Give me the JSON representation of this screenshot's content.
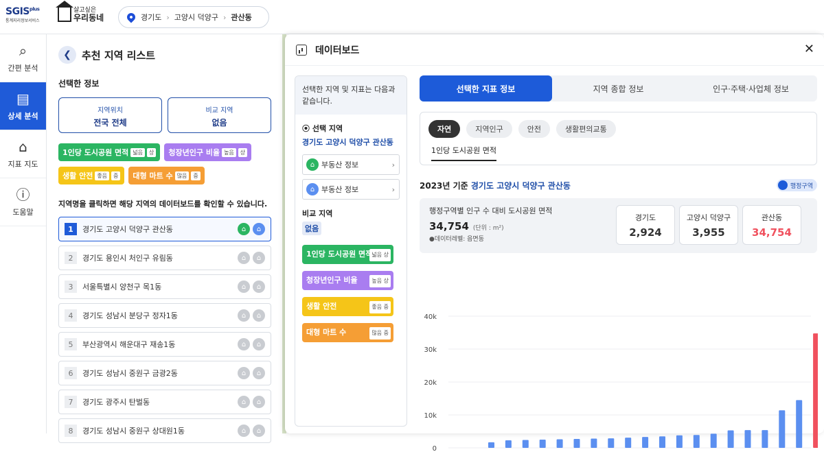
{
  "logo": {
    "main": "SGIS",
    "sup": "plus",
    "sub": "통계지리정보서비스"
  },
  "brand": {
    "line1": "살고싶은",
    "line2": "우리동네"
  },
  "breadcrumb": [
    "경기도",
    "고양시 덕양구",
    "관산동"
  ],
  "nav": [
    {
      "label": "간편 분석",
      "icon": "search-chart-icon"
    },
    {
      "label": "상세 분석",
      "icon": "document-search-icon"
    },
    {
      "label": "지표 지도",
      "icon": "house-map-icon"
    },
    {
      "label": "도움말",
      "icon": "info-icon"
    }
  ],
  "left": {
    "title": "추천 지역 리스트",
    "selected_label": "선택한 정보",
    "loc_title": "지역위치",
    "loc_value": "전국 전체",
    "cmp_title": "비교 지역",
    "cmp_value": "없음",
    "tags": [
      {
        "name": "1인당 도시공원 면적",
        "p1": "넓음",
        "p2": "상",
        "color": "#2bb562"
      },
      {
        "name": "청장년인구 비율",
        "p1": "높음",
        "p2": "상",
        "color": "#a97df0"
      },
      {
        "name": "생활 안전",
        "p1": "좋음",
        "p2": "중",
        "color": "#f5c518"
      },
      {
        "name": "대형 마트 수",
        "p1": "많음",
        "p2": "중",
        "color": "#f59e35"
      }
    ],
    "hint": "지역명을 클릭하면 해당 지역의 데이터보드를 확인할 수 있습니다.",
    "list": [
      {
        "rank": "1",
        "name": "경기도 고양시 덕양구 관산동"
      },
      {
        "rank": "2",
        "name": "경기도 용인시 처인구 유림동"
      },
      {
        "rank": "3",
        "name": "서울특별시 양천구 목1동"
      },
      {
        "rank": "4",
        "name": "경기도 성남시 분당구 정자1동"
      },
      {
        "rank": "5",
        "name": "부산광역시 해운대구 재송1동"
      },
      {
        "rank": "6",
        "name": "경기도 성남시 중원구 금광2동"
      },
      {
        "rank": "7",
        "name": "경기도 광주시 탄벌동"
      },
      {
        "rank": "8",
        "name": "경기도 성남시 중원구 상대원1동"
      }
    ]
  },
  "dashboard": {
    "title": "데이터보드",
    "intro": "선택한 지역 및 지표는 다음과 같습니다.",
    "sel_region_label": "선택 지역",
    "sel_region": "경기도 고양시 덕양구 관산동",
    "realestate1": "부동산 정보",
    "realestate2": "부동산 정보",
    "cmp_label": "비교 지역",
    "cmp_value": "없음",
    "tabs": [
      "선택한 지표 정보",
      "지역 종합 정보",
      "인구·주택·사업체 정보"
    ],
    "pills": [
      "자연",
      "지역인구",
      "안전",
      "생활편의교통"
    ],
    "subtab": "1인당 도시공원 면적",
    "year_prefix": "2023년 기준",
    "year_region": "경기도 고양시 덕양구 관산동",
    "toggle": "행정구역",
    "stat_desc": "행정구역별 인구 수 대비 도시공원 면적",
    "stat_value": "34,754",
    "stat_unit": "(단위 : m²)",
    "stat_level": "●데이터레벨: 읍면동",
    "cards": [
      {
        "name": "경기도",
        "value": "2,924"
      },
      {
        "name": "고양시 덕양구",
        "value": "3,955"
      },
      {
        "name": "관산동",
        "value": "34,754"
      }
    ]
  },
  "chart_data": {
    "type": "bar",
    "yticks": [
      "40k",
      "30k",
      "20k",
      "10k",
      "0"
    ],
    "ylim": [
      0,
      40000
    ],
    "values": [
      1700,
      2300,
      2400,
      2500,
      2600,
      2700,
      2800,
      2900,
      3100,
      3300,
      3500,
      3800,
      3900,
      4300,
      5300,
      5400,
      5400,
      11400,
      14500,
      34754
    ],
    "colors": {
      "default": "#5b8ff0",
      "highlight": "#f0515e"
    },
    "highlight_index": 19
  }
}
